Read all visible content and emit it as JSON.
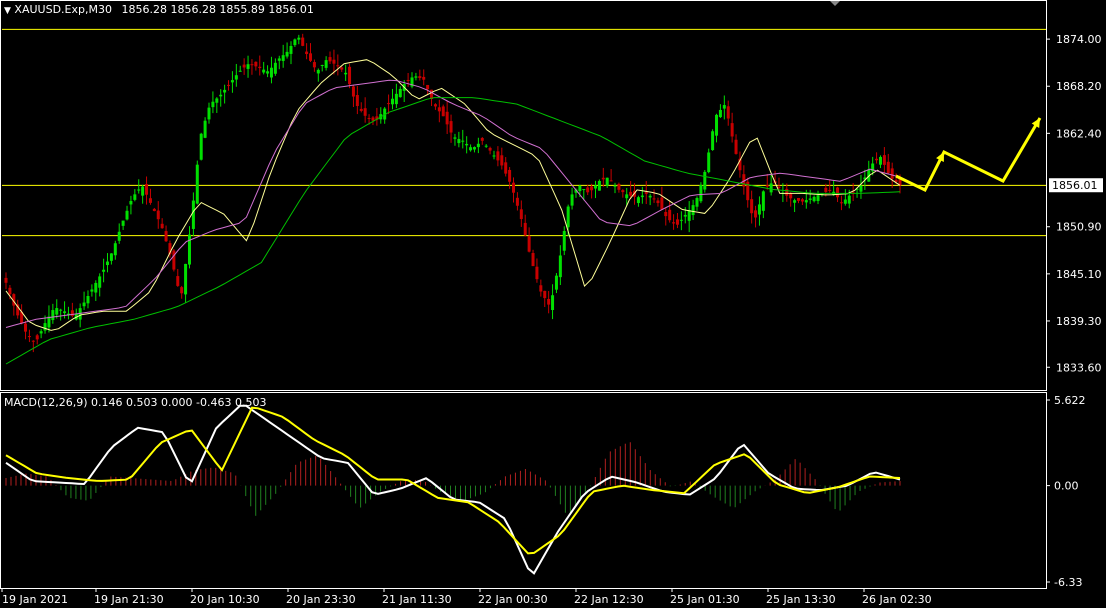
{
  "header": {
    "symbol": "XAUUSD.Exp,M30",
    "ohlc": "1856.28 1856.28 1855.89 1856.01",
    "macd_label": "MACD(12,26,9) 0.146 0.503 0.000 -0.463 0.503"
  },
  "colors": {
    "background": "#000000",
    "frame": "#ffffff",
    "bull_candle": "#00e000",
    "bear_candle": "#c80000",
    "hline": "#ffff00",
    "ma_fast": "#ffff99",
    "ma_mid": "#ffffff",
    "ma_violet": "#d070d0",
    "ma_slow": "#00c000",
    "macd_line": "#ffffff",
    "signal_line": "#ffff00",
    "hist_pos": "#b02020",
    "hist_neg": "#208020",
    "forecast_arrow": "#ffff00"
  },
  "chart_data": [
    {
      "type": "candlestick",
      "title": "XAUUSD.Exp,M30",
      "ylim": [
        1830.8,
        1876.6
      ],
      "y_ticks": [
        "1874.00",
        "1868.20",
        "1862.40",
        "1856.01",
        "1850.90",
        "1845.10",
        "1839.30",
        "1833.60"
      ],
      "current_price": "1856.01",
      "horizontal_levels": [
        1875.2,
        1856.0,
        1849.8
      ],
      "x_ticks": [
        "19 Jan 2021",
        "19 Jan 21:30",
        "20 Jan 10:30",
        "20 Jan 23:30",
        "21 Jan 11:30",
        "22 Jan 00:30",
        "22 Jan 12:30",
        "25 Jan 01:30",
        "25 Jan 13:30",
        "26 Jan 02:30"
      ],
      "price_path": [
        1844.0,
        1840.5,
        1838.0,
        1836.5,
        1839.0,
        1841.0,
        1840.5,
        1839.8,
        1841.5,
        1843.5,
        1845.5,
        1848.0,
        1851.5,
        1854.5,
        1856.0,
        1853.5,
        1851.0,
        1847.0,
        1842.0,
        1851.0,
        1862.0,
        1866.0,
        1867.0,
        1868.5,
        1870.0,
        1871.0,
        1870.5,
        1870.0,
        1871.5,
        1872.5,
        1874.5,
        1872.0,
        1870.0,
        1871.5,
        1870.8,
        1869.8,
        1866.0,
        1864.5,
        1863.8,
        1865.5,
        1867.0,
        1868.5,
        1869.5,
        1869.0,
        1866.0,
        1864.5,
        1862.0,
        1861.5,
        1860.5,
        1861.5,
        1860.0,
        1858.5,
        1856.0,
        1852.0,
        1847.0,
        1843.0,
        1841.0,
        1847.0,
        1854.5,
        1856.0,
        1855.0,
        1856.5,
        1857.0,
        1855.5,
        1854.8,
        1854.5,
        1855.0,
        1854.0,
        1852.0,
        1851.0,
        1852.5,
        1854.0,
        1858.0,
        1864.5,
        1866.0,
        1860.5,
        1855.5,
        1851.5,
        1855.5,
        1856.5,
        1855.0,
        1854.2,
        1854.0,
        1854.5,
        1855.0,
        1855.5,
        1853.8,
        1855.0,
        1856.0,
        1858.5,
        1859.5,
        1857.0,
        1856.0
      ],
      "moving_averages": [
        {
          "color_key": "ma_fast",
          "path": [
            1843.0,
            1839.0,
            1838.0,
            1840.0,
            1840.5,
            1840.5,
            1843.0,
            1849.0,
            1854.0,
            1852.5,
            1849.0,
            1858.0,
            1865.0,
            1868.5,
            1871.0,
            1871.5,
            1869.5,
            1866.5,
            1868.0,
            1866.0,
            1862.5,
            1861.0,
            1859.5,
            1853.0,
            1843.0,
            1849.0,
            1855.5,
            1855.0,
            1853.0,
            1852.5,
            1857.0,
            1862.5,
            1855.0,
            1855.0,
            1854.8,
            1855.0,
            1858.0,
            1856.0
          ]
        },
        {
          "color_key": "ma_violet",
          "path": [
            1838.5,
            1839.5,
            1840.0,
            1840.5,
            1841.0,
            1844.5,
            1849.0,
            1850.5,
            1851.5,
            1860.0,
            1866.0,
            1868.0,
            1868.5,
            1869.0,
            1868.0,
            1866.0,
            1864.5,
            1862.0,
            1860.5,
            1856.0,
            1851.5,
            1851.0,
            1853.0,
            1854.8,
            1855.0,
            1857.0,
            1857.5,
            1857.0,
            1856.5,
            1858.0,
            1857.0
          ]
        },
        {
          "color_key": "ma_slow",
          "path": [
            1834.0,
            1837.0,
            1838.5,
            1839.5,
            1841.0,
            1843.5,
            1846.5,
            1855.0,
            1862.0,
            1865.0,
            1866.8,
            1866.8,
            1866.0,
            1864.0,
            1862.0,
            1859.0,
            1857.5,
            1856.5,
            1855.5,
            1855.0,
            1855.0,
            1855.2
          ]
        }
      ]
    },
    {
      "type": "line",
      "title": "MACD(12,26,9)",
      "ylim": [
        -6.33,
        5.622
      ],
      "y_ticks": [
        "5.622",
        "0.00",
        "-6.33"
      ],
      "series": [
        {
          "name": "MACD",
          "color_key": "macd_line",
          "values": [
            1.5,
            0.3,
            0.2,
            0.1,
            2.5,
            3.8,
            3.5,
            0.0,
            3.8,
            5.4,
            4.2,
            3.0,
            1.8,
            1.5,
            -0.6,
            -0.2,
            0.5,
            -0.9,
            -1.1,
            -2.2,
            -6.0,
            -3.0,
            -0.5,
            0.6,
            0.2,
            -0.4,
            -0.6,
            0.5,
            2.8,
            0.8,
            -0.2,
            -0.3,
            0.0,
            0.9,
            0.4
          ]
        },
        {
          "name": "Signal",
          "color_key": "signal_line",
          "values": [
            2.0,
            0.8,
            0.5,
            0.3,
            0.4,
            2.8,
            3.7,
            1.0,
            5.2,
            4.5,
            3.0,
            2.0,
            0.4,
            0.4,
            -0.8,
            -1.1,
            -2.4,
            -4.6,
            -3.2,
            -0.4,
            0.0,
            -0.3,
            -0.5,
            1.4,
            2.1,
            0.1,
            -0.5,
            -0.1,
            0.6,
            0.5
          ]
        },
        {
          "name": "Histogram",
          "color_key": "hist_pos",
          "values": [
            0.5,
            0.8,
            0.6,
            -0.8,
            -1.0,
            0.6,
            0.5,
            0.4,
            0.3,
            1.0,
            1.2,
            0.8,
            -2.0,
            -0.5,
            1.5,
            2.0,
            0.3,
            -1.5,
            -0.4,
            0.3,
            0.4,
            -0.5,
            -1.0,
            -0.5,
            0.6,
            1.1,
            0.3,
            -2.0,
            -0.3,
            2.2,
            2.9,
            1.0,
            -0.1,
            0.3,
            -0.7,
            -1.5,
            -0.4,
            0.4,
            1.8,
            0.3,
            -1.8,
            -0.4,
            0.2,
            0.3
          ]
        }
      ]
    }
  ]
}
